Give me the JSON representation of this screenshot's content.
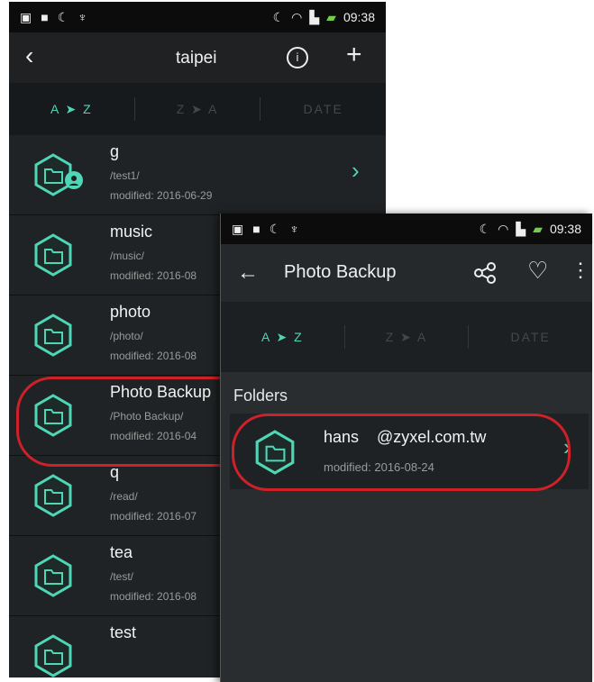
{
  "status_time": "09:38",
  "phone1": {
    "header": {
      "title": "taipei"
    },
    "sort": {
      "az": "A ➤ Z",
      "za": "Z ➤ A",
      "date": "DATE"
    },
    "rows": [
      {
        "name": "g",
        "path": "/test1/",
        "modified": "modified: 2016-06-29"
      },
      {
        "name": "music",
        "path": "/music/",
        "modified": "modified: 2016-08"
      },
      {
        "name": "photo",
        "path": "/photo/",
        "modified": "modified: 2016-08"
      },
      {
        "name": "Photo Backup",
        "path": "/Photo Backup/",
        "modified": "modified: 2016-04"
      },
      {
        "name": "q",
        "path": "/read/",
        "modified": "modified: 2016-07"
      },
      {
        "name": "tea",
        "path": "/test/",
        "modified": "modified: 2016-08"
      },
      {
        "name": "test",
        "path": "",
        "modified": ""
      }
    ]
  },
  "phone2": {
    "header": {
      "title": "Photo Backup"
    },
    "sort": {
      "az": "A ➤ Z",
      "za": "Z ➤ A",
      "date": "DATE"
    },
    "section_label": "Folders",
    "folder": {
      "name": "hans    @zyxel.com.tw",
      "modified": "modified: 2016-08-24"
    }
  },
  "colors": {
    "accent": "#4fd6b7",
    "highlight": "#d0212a"
  }
}
